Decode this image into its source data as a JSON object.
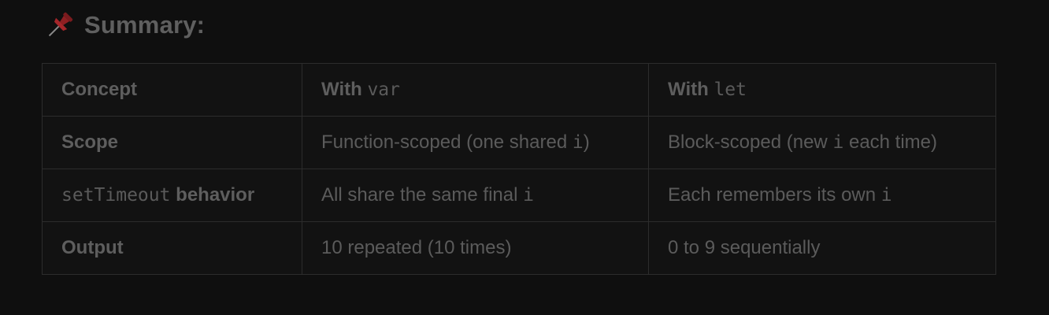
{
  "heading": {
    "icon": "pushpin-icon",
    "text": "Summary:"
  },
  "table": {
    "headers": [
      {
        "text": "Concept",
        "code": ""
      },
      {
        "text": "With ",
        "code": "var"
      },
      {
        "text": "With ",
        "code": "let"
      }
    ],
    "rows": [
      {
        "concept": {
          "code": "",
          "text": "Scope"
        },
        "with_var": {
          "before": "Function-scoped (one shared ",
          "code": "i",
          "after": ")"
        },
        "with_let": {
          "before": "Block-scoped (new ",
          "code": "i",
          "after": " each time)"
        }
      },
      {
        "concept": {
          "code": "setTimeout",
          "text": " behavior"
        },
        "with_var": {
          "before": "All share the same final ",
          "code": "i",
          "after": ""
        },
        "with_let": {
          "before": "Each remembers its own ",
          "code": "i",
          "after": ""
        }
      },
      {
        "concept": {
          "code": "",
          "text": "Output"
        },
        "with_var": {
          "before": "10 repeated (10 times)",
          "code": "",
          "after": ""
        },
        "with_let": {
          "before": "0 to 9 sequentially",
          "code": "",
          "after": ""
        }
      }
    ]
  },
  "colors": {
    "background": "#0f0f0f",
    "text": "#5a5a5a",
    "border": "#2c2c2c",
    "pin_red": "#8e1f22"
  }
}
